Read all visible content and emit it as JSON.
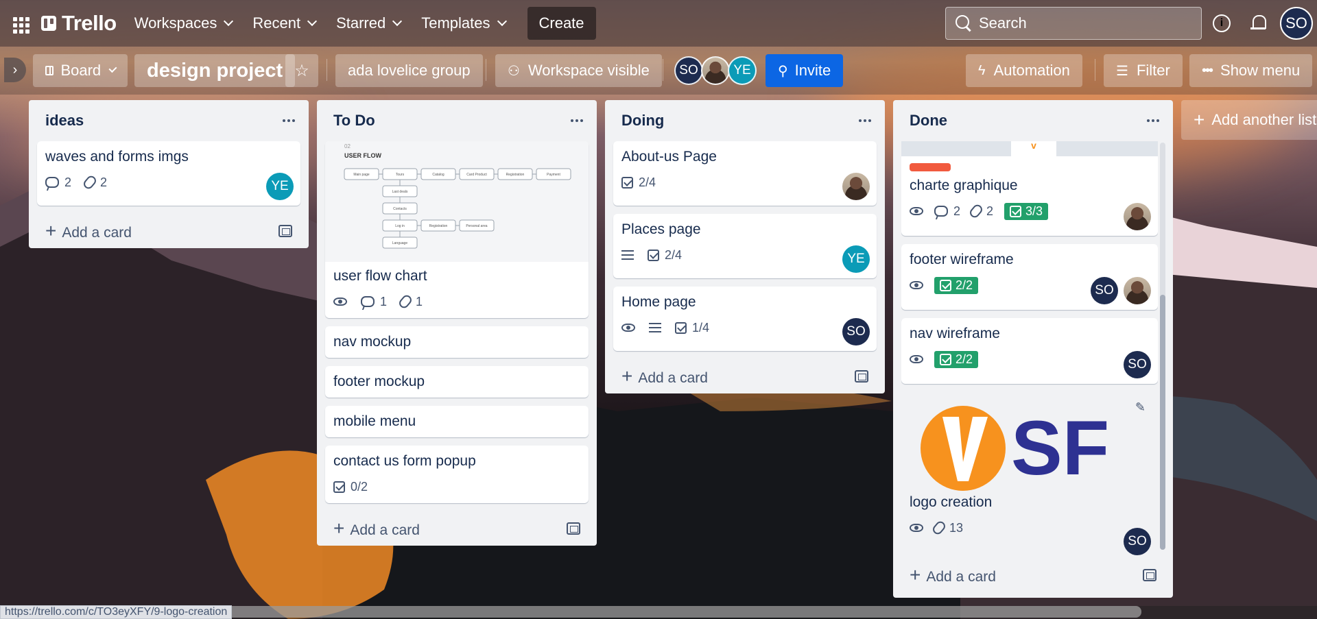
{
  "topnav": {
    "logo": "Trello",
    "items": [
      "Workspaces",
      "Recent",
      "Starred",
      "Templates"
    ],
    "create": "Create",
    "search_placeholder": "Search",
    "user_initials": "SO"
  },
  "board": {
    "view": "Board",
    "title": "design project",
    "workspace": "ada lovelice group",
    "visibility": "Workspace visible",
    "members": [
      "SO",
      "YE"
    ],
    "invite": "Invite",
    "automation": "Automation",
    "filter": "Filter",
    "show_menu": "Show menu",
    "add_list": "Add another list"
  },
  "lists": {
    "ideas": {
      "name": "ideas",
      "add": "Add a card",
      "cards": [
        {
          "title": "waves and forms imgs",
          "comments": "2",
          "attachments": "2",
          "member": "YE"
        }
      ]
    },
    "todo": {
      "name": "To Do",
      "add": "Add a card",
      "flow": {
        "step": "02",
        "heading": "USER FLOW",
        "nodes": [
          "Main page",
          "Tours",
          "Catalog",
          "Card Product",
          "Registration",
          "Payment",
          "Last deals",
          "Contacts",
          "Log in",
          "Registration",
          "Personal area",
          "Language"
        ]
      },
      "cards": [
        {
          "title": "user flow chart",
          "comments": "1",
          "attachments": "1"
        },
        {
          "title": "nav mockup"
        },
        {
          "title": "footer mockup"
        },
        {
          "title": "mobile menu"
        },
        {
          "title": "contact us form popup",
          "checklist": "0/2"
        }
      ]
    },
    "doing": {
      "name": "Doing",
      "add": "Add a card",
      "cards": [
        {
          "title": "About-us Page",
          "checklist": "2/4"
        },
        {
          "title": "Places page",
          "checklist": "2/4",
          "member": "YE"
        },
        {
          "title": "Home page",
          "checklist": "1/4",
          "member": "SO"
        }
      ]
    },
    "done": {
      "name": "Done",
      "add": "Add a card",
      "cards": [
        {
          "title": "charte graphique",
          "comments": "2",
          "attachments": "2",
          "checklist": "3/3"
        },
        {
          "title": "footer wireframe",
          "checklist": "2/2",
          "member": "SO"
        },
        {
          "title": "nav wireframe",
          "checklist": "2/2",
          "member": "SO"
        },
        {
          "title": "logo creation",
          "attachments": "13",
          "member": "SO",
          "logo_text": "SF"
        }
      ]
    }
  },
  "status_url": "https://trello.com/c/TO3eyXFY/9-logo-creation",
  "colors": {
    "accent": "#0c66e4",
    "done_badge": "#22a06b",
    "label_red": "#f15a3e",
    "so_avatar": "#1d2b4f",
    "ye_avatar": "#0b9bb7",
    "logo_orange": "#f7921e",
    "logo_navy": "#2e3192"
  }
}
